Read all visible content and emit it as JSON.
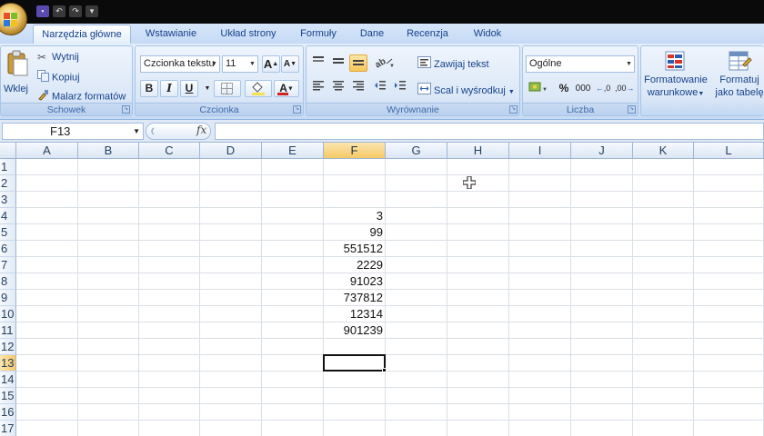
{
  "tabs": [
    "Narzędzia główne",
    "Wstawianie",
    "Układ strony",
    "Formuły",
    "Dane",
    "Recenzja",
    "Widok"
  ],
  "clipboard": {
    "paste": "Wklej",
    "cut": "Wytnij",
    "copy": "Kopiuj",
    "format_painter": "Malarz formatów",
    "label": "Schowek"
  },
  "font": {
    "name": "Czcionka tekstu",
    "size": "11",
    "label": "Czcionka",
    "bold": "B",
    "italic": "I",
    "underline": "U",
    "font_color": "A",
    "grow": "A",
    "shrink": "A",
    "font_color_hex": "#d21f1f",
    "fill_color_hex": "#f7e24a"
  },
  "alignment": {
    "wrap": "Zawijaj tekst",
    "merge": "Scal i wyśrodkuj",
    "label": "Wyrównanie"
  },
  "number": {
    "format": "Ogólne",
    "label": "Liczba",
    "percent": "%",
    "thousands": "000",
    "increase_decimal": ",0",
    "decrease_decimal": ",00"
  },
  "styles": {
    "conditional_1": "Formatowanie",
    "conditional_2": "warunkowe",
    "table_1": "Formatuj",
    "table_2": "jako tabelę"
  },
  "formula_bar": {
    "cell_ref": "F13",
    "fx": "fx",
    "content": ""
  },
  "columns": [
    "A",
    "B",
    "C",
    "D",
    "E",
    "F",
    "G",
    "H",
    "I",
    "J",
    "K",
    "L"
  ],
  "rows": [
    "1",
    "2",
    "3",
    "4",
    "5",
    "6",
    "7",
    "8",
    "9",
    "10",
    "11",
    "12",
    "13",
    "14",
    "15",
    "16",
    "17"
  ],
  "cells": [
    {
      "row": "4",
      "col": "F",
      "value": "3"
    },
    {
      "row": "5",
      "col": "F",
      "value": "99"
    },
    {
      "row": "6",
      "col": "F",
      "value": "551512"
    },
    {
      "row": "7",
      "col": "F",
      "value": "2229"
    },
    {
      "row": "8",
      "col": "F",
      "value": "91023"
    },
    {
      "row": "9",
      "col": "F",
      "value": "737812"
    },
    {
      "row": "10",
      "col": "F",
      "value": "12314"
    },
    {
      "row": "11",
      "col": "F",
      "value": "901239"
    }
  ],
  "selected_cell": {
    "row": "13",
    "col": "F"
  },
  "colors": {
    "selection_header": "#f6c866",
    "ribbon": "#dbe7f7"
  }
}
